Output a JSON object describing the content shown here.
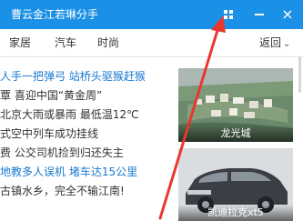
{
  "window": {
    "title": "曹云金江若琳分手",
    "close_icon": "×",
    "icons": [
      "grid-icon",
      "minimize-icon",
      "close-icon"
    ]
  },
  "tabs": {
    "items": [
      "家居",
      "汽车",
      "时尚"
    ],
    "back_label": "返回",
    "back_icon": "chevron-down-icon"
  },
  "news": [
    {
      "text": "人手一把弹弓 站桥头驱猴赶猴",
      "color": "#1a7ad0"
    },
    {
      "text": "覃 喜迎中国“黄金周”",
      "color": "#333333"
    },
    {
      "text": "北京大雨或暴雨 最低温12℃",
      "color": "#333333"
    },
    {
      "text": "式空中列车成功挂线",
      "color": "#333333"
    },
    {
      "text": "费 公交司机捡到归还失主",
      "color": "#333333"
    },
    {
      "text": "地教多人误机 堵车达15公里",
      "color": "#1a7ad0"
    },
    {
      "text": "古镇水乡，完全不输江南!",
      "color": "#333333"
    }
  ],
  "thumbnails": [
    {
      "caption": "龙光城"
    },
    {
      "caption": "凯迪拉克xt5"
    }
  ],
  "colors": {
    "titlebar": "#1a90e6",
    "link_blue": "#1a7ad0",
    "arrow_red": "#e8372e"
  }
}
